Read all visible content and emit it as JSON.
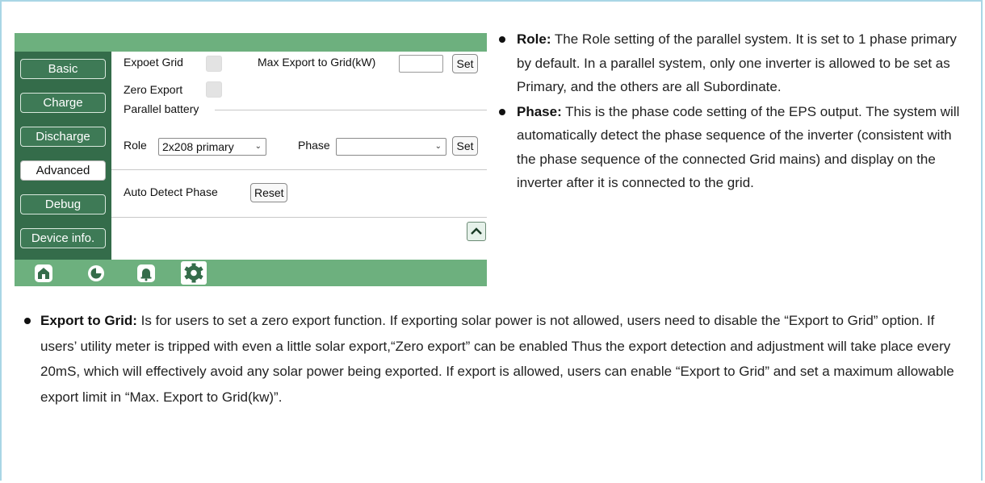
{
  "panel": {
    "sidebar": {
      "items": [
        {
          "label": "Basic",
          "active": false
        },
        {
          "label": "Charge",
          "active": false
        },
        {
          "label": "Discharge",
          "active": false
        },
        {
          "label": "Advanced",
          "active": true
        },
        {
          "label": "Debug",
          "active": false
        },
        {
          "label": "Device info.",
          "active": false
        }
      ]
    },
    "content": {
      "export_grid_label": "Expoet Grid",
      "max_export_label": "Max Export to Grid(kW)",
      "max_export_value": "",
      "set_label": "Set",
      "zero_export_label": "Zero Export",
      "parallel_battery_label": "Parallel battery",
      "role_label": "Role",
      "role_value": "2x208 primary",
      "phase_label": "Phase",
      "phase_value": "",
      "auto_detect_label": "Auto Detect Phase",
      "reset_label": "Reset"
    },
    "tabs": [
      "home-icon",
      "chart-icon",
      "bell-icon",
      "settings-icon"
    ],
    "colors": {
      "header_green": "#6db07e",
      "sidebar_green": "#346c4a"
    }
  },
  "doc": {
    "role_term": "Role:",
    "role_text": " The Role setting of the parallel system. It is set to 1 phase primary by default. In a parallel system, only one inverter is allowed to be set as Primary, and the others are all Subordinate.",
    "phase_term": "Phase:",
    "phase_text": " This is the phase code setting of the EPS output. The system will automatically detect the phase sequence of the inverter (consistent with the phase sequence of the connected Grid mains) and display on the inverter after it is connected to the grid.",
    "export_term": "Export to Grid:",
    "export_text": " Is for users to set a zero export function. If exporting solar power is not allowed, users need to disable the “Export to Grid” option. If users’ utility meter is tripped with even a little solar export,“Zero export” can be enabled Thus the export detection and adjustment will take place every 20mS, which will effectively avoid any solar power being exported. If export is allowed, users can enable “Export to Grid” and set a maximum allowable export limit in “Max. Export to Grid(kw)”."
  }
}
